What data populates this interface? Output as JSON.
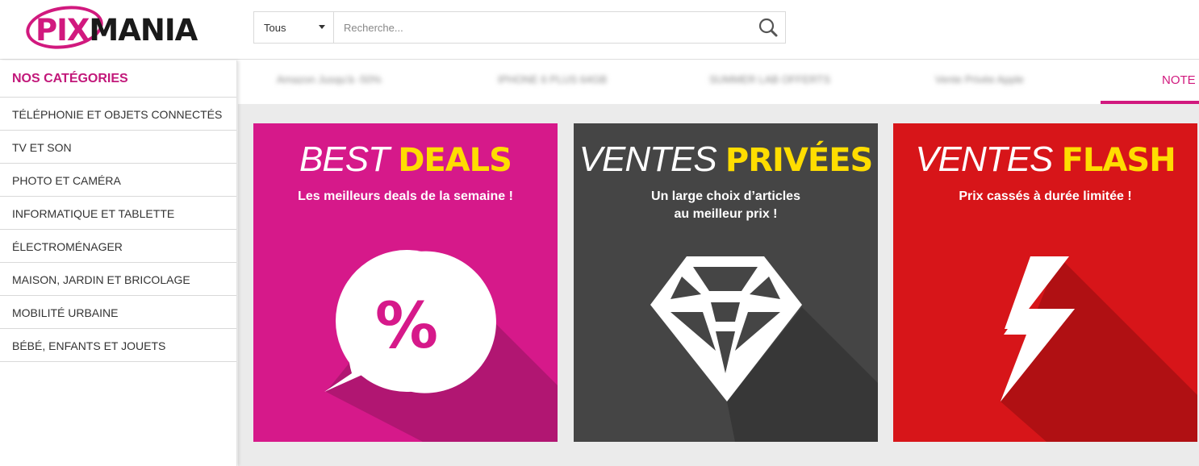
{
  "header": {
    "logo": {
      "pix": "PIX",
      "mania": "MANIA"
    },
    "search": {
      "category_label": "Tous",
      "placeholder": "Recherche..."
    }
  },
  "sidebar": {
    "title": "NOS CATÉGORIES",
    "items": [
      {
        "label": "TÉLÉPHONIE ET OBJETS CONNECTÉS"
      },
      {
        "label": "TV ET SON"
      },
      {
        "label": "PHOTO ET CAMÉRA"
      },
      {
        "label": "INFORMATIQUE ET TABLETTE"
      },
      {
        "label": "ÉLECTROMÉNAGER"
      },
      {
        "label": "MAISON, JARDIN ET BRICOLAGE"
      },
      {
        "label": "MOBILITÉ URBAINE"
      },
      {
        "label": "BÉBÉ, ENFANTS ET JOUETS"
      }
    ]
  },
  "tabs": {
    "items": [
      {
        "label": "Amazon Jusqu'à -50%"
      },
      {
        "label": "IPHONE 6 PLUS 64GB"
      },
      {
        "label": "SUMMER LAB OFFERTS"
      },
      {
        "label": "Vente Privée Apple"
      }
    ],
    "active_label": "NOTE"
  },
  "cards": [
    {
      "title_light": "BEST",
      "title_bold": "DEALS",
      "subtitle": "Les meilleurs deals de la semaine !",
      "icon": "percent-bubble-icon",
      "color": "#d6198a",
      "shadow": "#b11672"
    },
    {
      "title_light": "VENTES",
      "title_bold": "PRIVÉES",
      "subtitle": "Un large choix d’articles au meilleur prix !",
      "icon": "diamond-icon",
      "color": "#454545",
      "shadow": "#373737"
    },
    {
      "title_light": "VENTES",
      "title_bold": "FLASH",
      "subtitle": "Prix cassés à durée limitée !",
      "icon": "lightning-icon",
      "color": "#d71519",
      "shadow": "#b01013"
    }
  ],
  "colors": {
    "accent": "#d1197e",
    "title_highlight": "#ffdd00"
  }
}
